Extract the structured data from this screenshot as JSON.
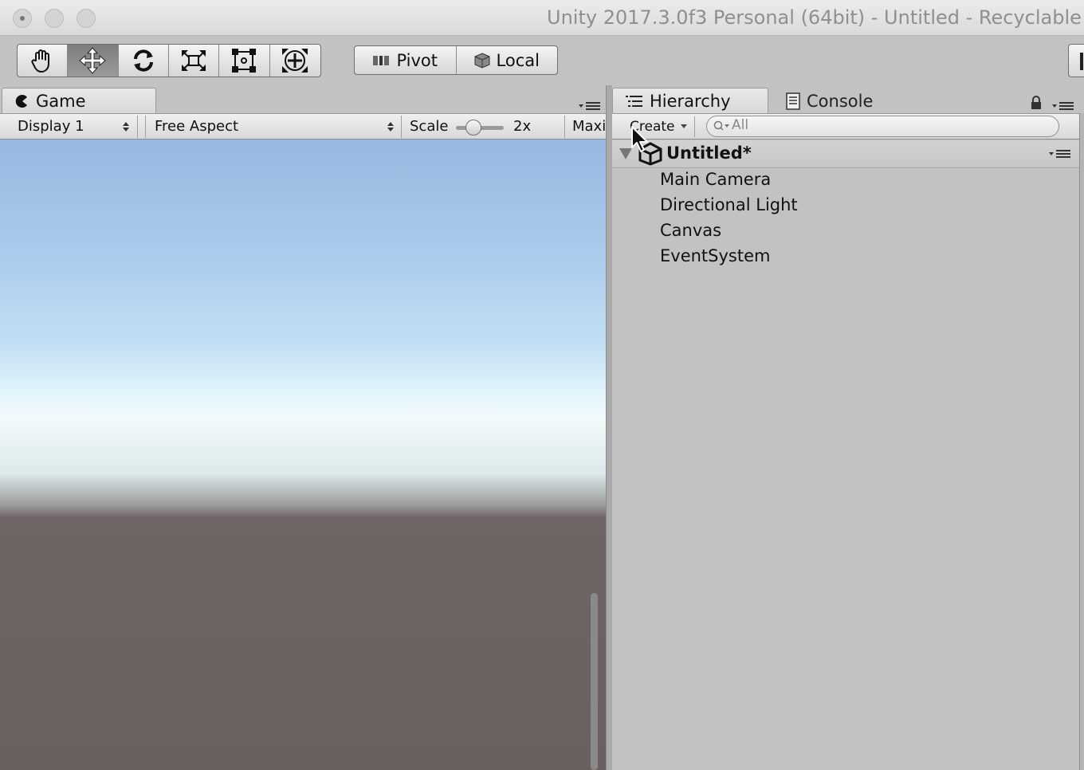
{
  "window": {
    "title": "Unity 2017.3.0f3 Personal (64bit) - Untitled - Recyclable"
  },
  "toolbar": {
    "tools": [
      {
        "name": "hand-tool",
        "icon": "hand-icon",
        "active": false
      },
      {
        "name": "move-tool",
        "icon": "move-arrows-icon",
        "active": true
      },
      {
        "name": "rotate-tool",
        "icon": "rotate-icon",
        "active": false
      },
      {
        "name": "scale-tool",
        "icon": "scale-icon",
        "active": false
      },
      {
        "name": "rect-tool",
        "icon": "rect-transform-icon",
        "active": false
      },
      {
        "name": "transform-tool",
        "icon": "transform-icon",
        "active": false
      }
    ],
    "pivot_label": "Pivot",
    "local_label": "Local"
  },
  "game": {
    "tab_label": "Game",
    "display_label": "Display 1",
    "aspect_label": "Free Aspect",
    "scale_label": "Scale",
    "scale_value": "2x",
    "maximize_label": "Maxi"
  },
  "hierarchy": {
    "tab_label": "Hierarchy",
    "console_tab_label": "Console",
    "create_label": "Create",
    "search_placeholder": "All",
    "scene_name": "Untitled*",
    "items": [
      "Main Camera",
      "Directional Light",
      "Canvas",
      "EventSystem"
    ]
  },
  "colors": {
    "panel_bg": "#c2c2c2",
    "sky_top": "#97b9e0",
    "horizon": "#f2fbfc",
    "ground": "#6a6060"
  }
}
